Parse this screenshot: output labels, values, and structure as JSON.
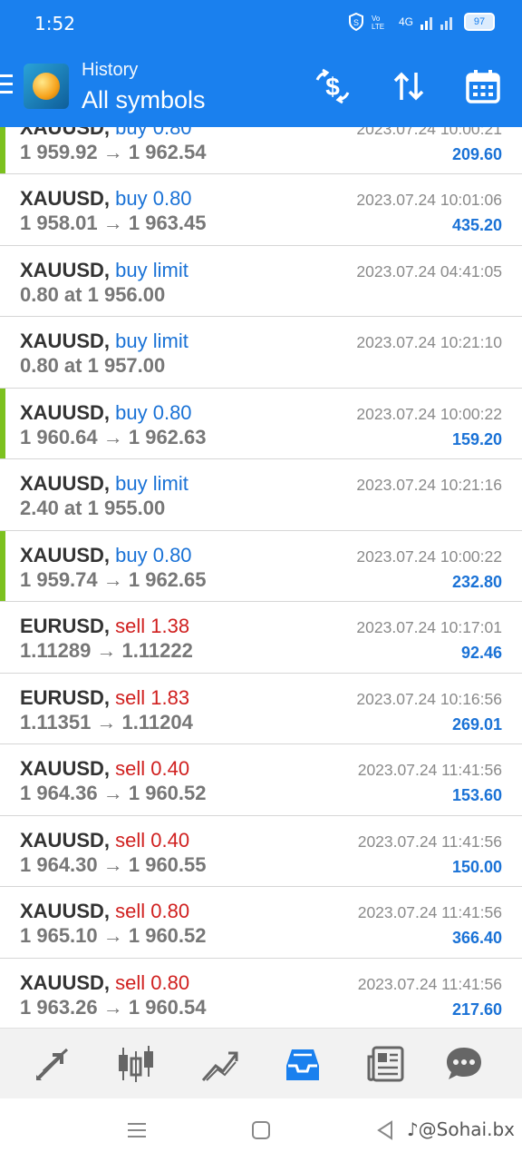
{
  "status_bar": {
    "time": "1:52",
    "network": "4G",
    "battery": "97"
  },
  "app_bar": {
    "subtitle": "History",
    "title": "All symbols"
  },
  "deals": [
    {
      "symbol": "XAUUSD,",
      "side": "buy 0.80",
      "side_type": "buy",
      "prices": "1 959.92 → 1 962.54",
      "date": "2023.07.24 10:00:21",
      "profit": "209.60",
      "bar": true,
      "partial": true
    },
    {
      "symbol": "XAUUSD,",
      "side": "buy 0.80",
      "side_type": "buy",
      "prices": "1 958.01 → 1 963.45",
      "date": "2023.07.24 10:01:06",
      "profit": "435.20",
      "bar": false
    },
    {
      "symbol": "XAUUSD,",
      "side": "buy limit",
      "side_type": "buy",
      "prices": "0.80 at 1 956.00",
      "date": "2023.07.24 04:41:05",
      "profit": "",
      "bar": false
    },
    {
      "symbol": "XAUUSD,",
      "side": "buy limit",
      "side_type": "buy",
      "prices": "0.80 at 1 957.00",
      "date": "2023.07.24 10:21:10",
      "profit": "",
      "bar": false
    },
    {
      "symbol": "XAUUSD,",
      "side": "buy 0.80",
      "side_type": "buy",
      "prices": "1 960.64 → 1 962.63",
      "date": "2023.07.24 10:00:22",
      "profit": "159.20",
      "bar": true
    },
    {
      "symbol": "XAUUSD,",
      "side": "buy limit",
      "side_type": "buy",
      "prices": "2.40 at 1 955.00",
      "date": "2023.07.24 10:21:16",
      "profit": "",
      "bar": false
    },
    {
      "symbol": "XAUUSD,",
      "side": "buy 0.80",
      "side_type": "buy",
      "prices": "1 959.74 → 1 962.65",
      "date": "2023.07.24 10:00:22",
      "profit": "232.80",
      "bar": true
    },
    {
      "symbol": "EURUSD,",
      "side": "sell 1.38",
      "side_type": "sell",
      "prices": "1.11289 → 1.11222",
      "date": "2023.07.24 10:17:01",
      "profit": "92.46",
      "bar": false
    },
    {
      "symbol": "EURUSD,",
      "side": "sell 1.83",
      "side_type": "sell",
      "prices": "1.11351 → 1.11204",
      "date": "2023.07.24 10:16:56",
      "profit": "269.01",
      "bar": false
    },
    {
      "symbol": "XAUUSD,",
      "side": "sell 0.40",
      "side_type": "sell",
      "prices": "1 964.36 → 1 960.52",
      "date": "2023.07.24 11:41:56",
      "profit": "153.60",
      "bar": false
    },
    {
      "symbol": "XAUUSD,",
      "side": "sell 0.40",
      "side_type": "sell",
      "prices": "1 964.30 → 1 960.55",
      "date": "2023.07.24 11:41:56",
      "profit": "150.00",
      "bar": false
    },
    {
      "symbol": "XAUUSD,",
      "side": "sell 0.80",
      "side_type": "sell",
      "prices": "1 965.10 → 1 960.52",
      "date": "2023.07.24 11:41:56",
      "profit": "366.40",
      "bar": false
    },
    {
      "symbol": "XAUUSD,",
      "side": "sell 0.80",
      "side_type": "sell",
      "prices": "1 963.26 → 1 960.54",
      "date": "2023.07.24 11:41:56",
      "profit": "217.60",
      "bar": false
    }
  ],
  "bottom_nav": [
    {
      "name": "trade-icon"
    },
    {
      "name": "chart-candles-icon"
    },
    {
      "name": "trend-icon"
    },
    {
      "name": "history-inbox-icon",
      "active": true
    },
    {
      "name": "news-icon"
    },
    {
      "name": "chat-icon"
    }
  ],
  "colors": {
    "accent": "#1a80ee",
    "buy": "#1a72d6",
    "sell": "#d0201f",
    "bar": "#7cc11f"
  },
  "watermark": "♪@Sohai.bx"
}
